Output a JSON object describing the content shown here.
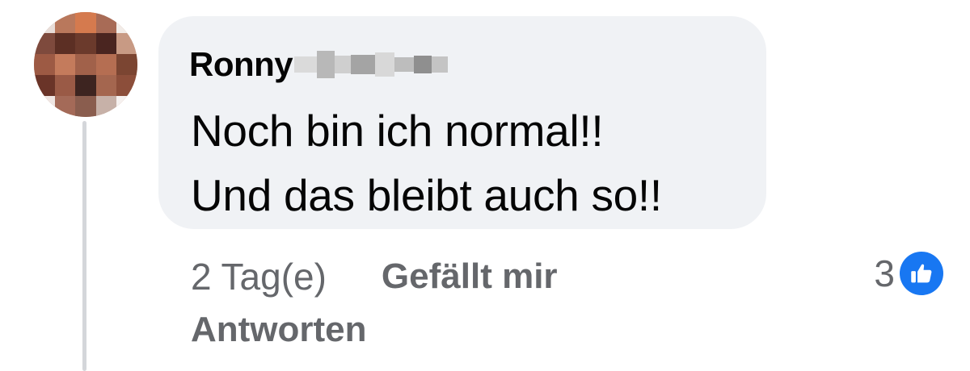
{
  "comment": {
    "author": "Ronny",
    "lines": [
      "Noch bin ich normal!!",
      "Und das bleibt auch so!!"
    ],
    "time": "2 Tag(e)",
    "like_label": "Gefällt mir",
    "reply_label": "Antworten",
    "reaction_count": "3",
    "reaction_icon": "thumbs-up-icon"
  },
  "colors": {
    "bubble": "#f0f2f5",
    "text": "#050505",
    "meta": "#65676b",
    "like_blue": "#1877f2"
  }
}
